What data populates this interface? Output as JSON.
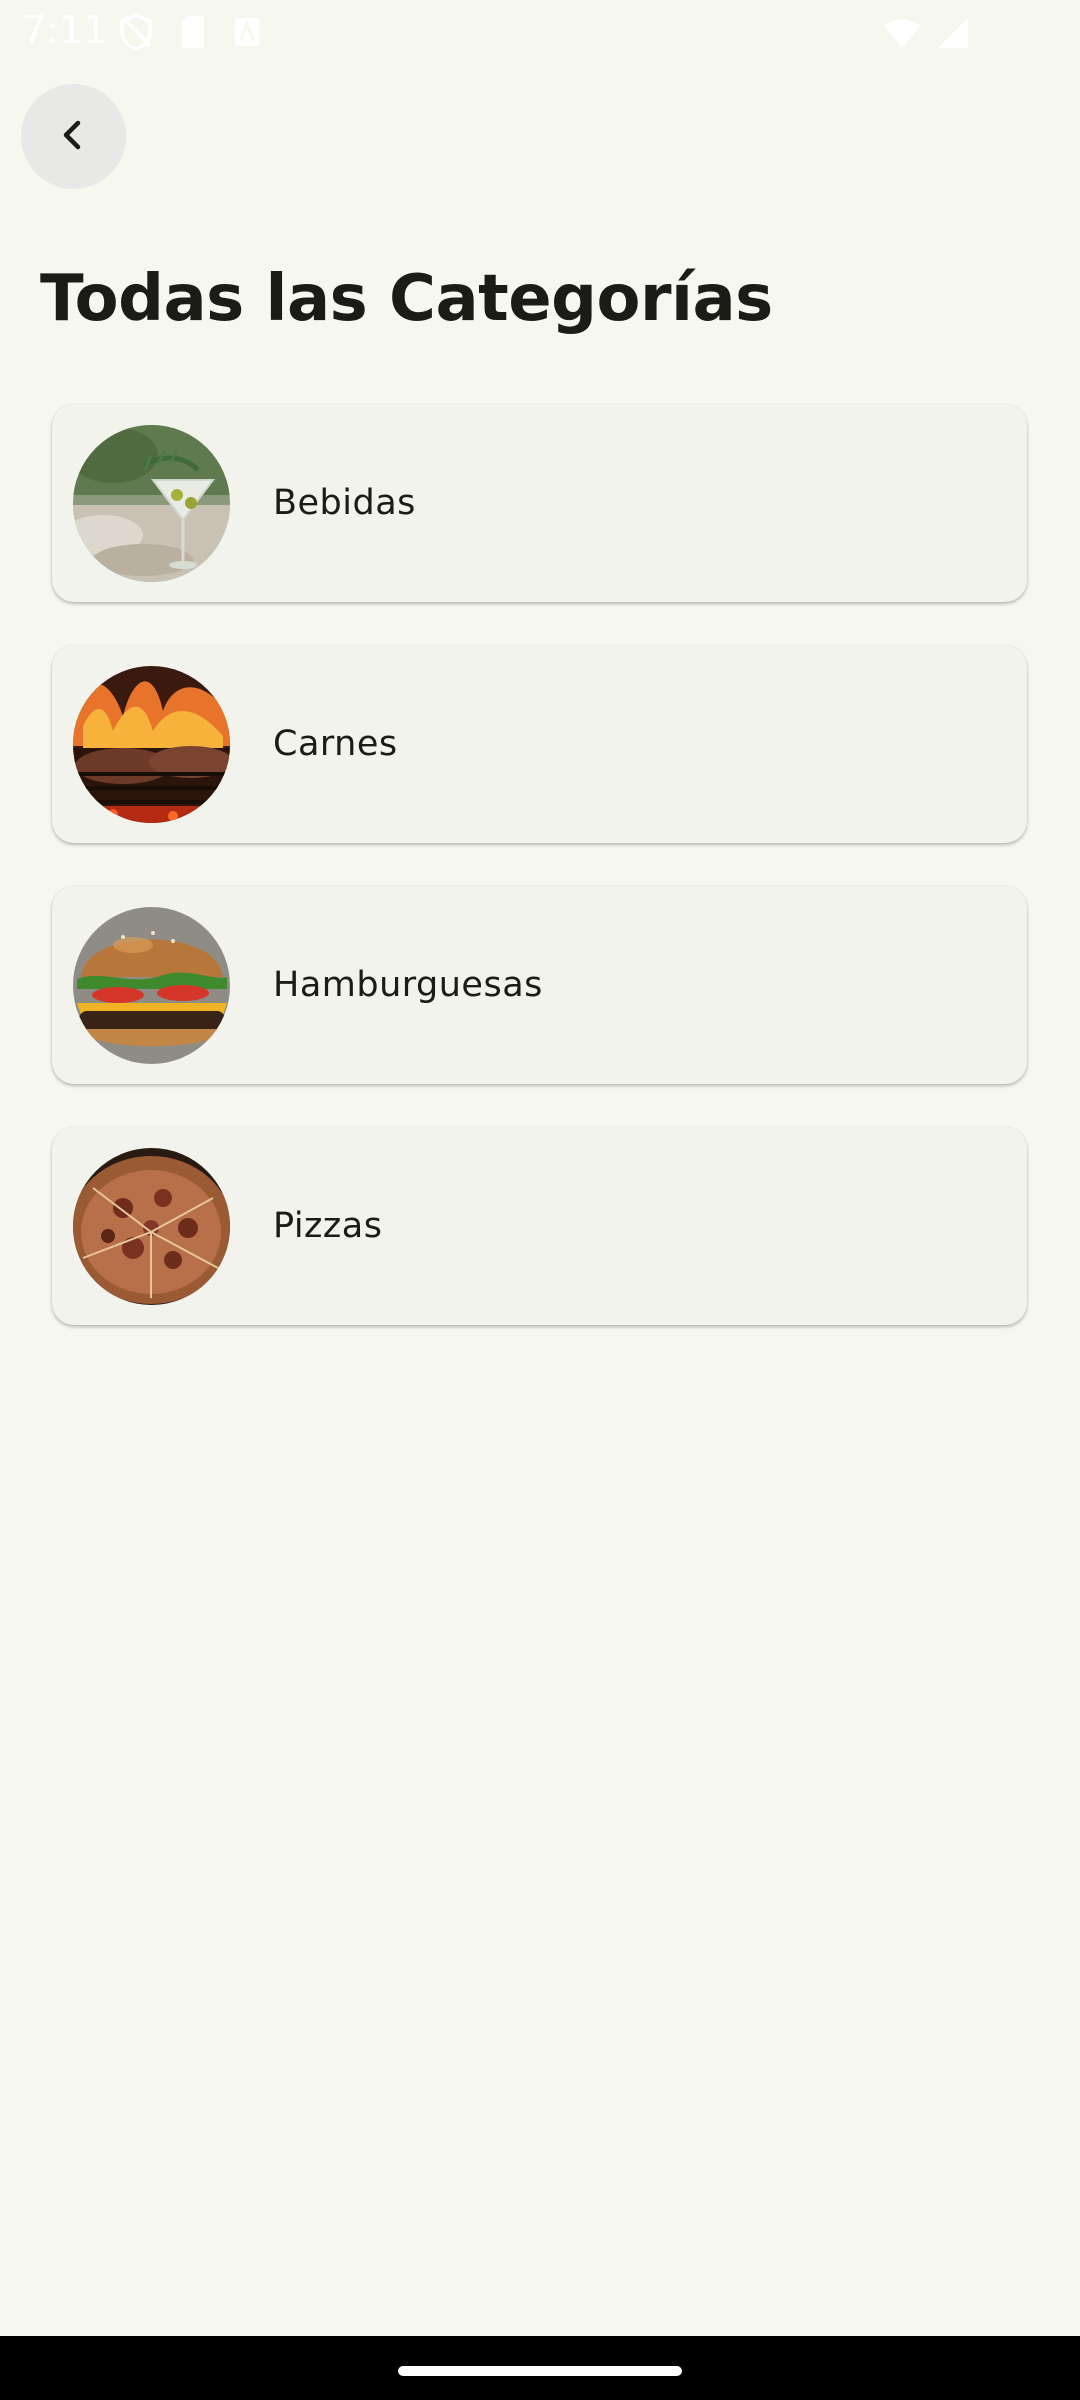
{
  "status_bar": {
    "time": "7:11",
    "icons_left": [
      "shield-icon",
      "sd-card-icon",
      "text-icon"
    ],
    "icons_right": [
      "wifi-icon",
      "signal-icon"
    ]
  },
  "header": {
    "back_icon": "chevron-left-icon",
    "title": "Todas las Categorías"
  },
  "categories": [
    {
      "label": "Bebidas",
      "image": "cocktail-photo"
    },
    {
      "label": "Carnes",
      "image": "grilled-meat-photo"
    },
    {
      "label": "Hamburguesas",
      "image": "burger-photo"
    },
    {
      "label": "Pizzas",
      "image": "pizza-photo"
    }
  ],
  "colors": {
    "background": "#f6f8f0",
    "card": "#f1f3ec",
    "text": "#1b1c18"
  }
}
